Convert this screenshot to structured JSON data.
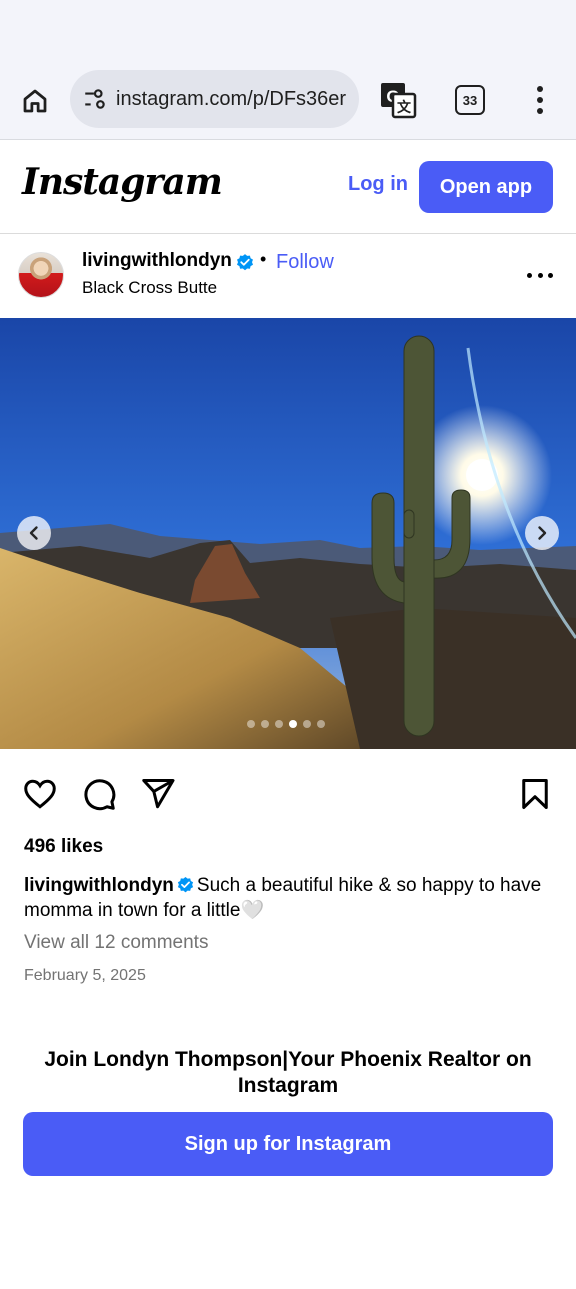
{
  "browser": {
    "url": "instagram.com/p/DFs36er",
    "tab_count": "33"
  },
  "header": {
    "logo": "Instagram",
    "login_label": "Log in",
    "open_app_label": "Open app"
  },
  "post": {
    "username": "livingwithlondyn",
    "dot": "•",
    "follow_label": "Follow",
    "location": "Black Cross Butte",
    "carousel": {
      "total": 6,
      "active": 3
    },
    "likes": "496 likes",
    "caption_user": "livingwithlondyn",
    "caption_text": "Such a beautiful hike & so happy to have momma in town for a little🤍",
    "view_comments": "View all 12 comments",
    "date": "February 5, 2025"
  },
  "signup": {
    "title": "Join Londyn Thompson|Your Phoenix Realtor on Instagram",
    "button_label": "Sign up for Instagram"
  },
  "colors": {
    "accent": "#4a5cf6",
    "verified": "#0095f6",
    "muted_text": "#737373"
  },
  "icons": [
    "home-icon",
    "tune-icon",
    "translate-icon",
    "tabs-icon",
    "more-vert-icon",
    "verified-icon",
    "more-horiz-icon",
    "chevron-left-icon",
    "chevron-right-icon",
    "heart-icon",
    "comment-icon",
    "share-icon",
    "bookmark-icon"
  ]
}
